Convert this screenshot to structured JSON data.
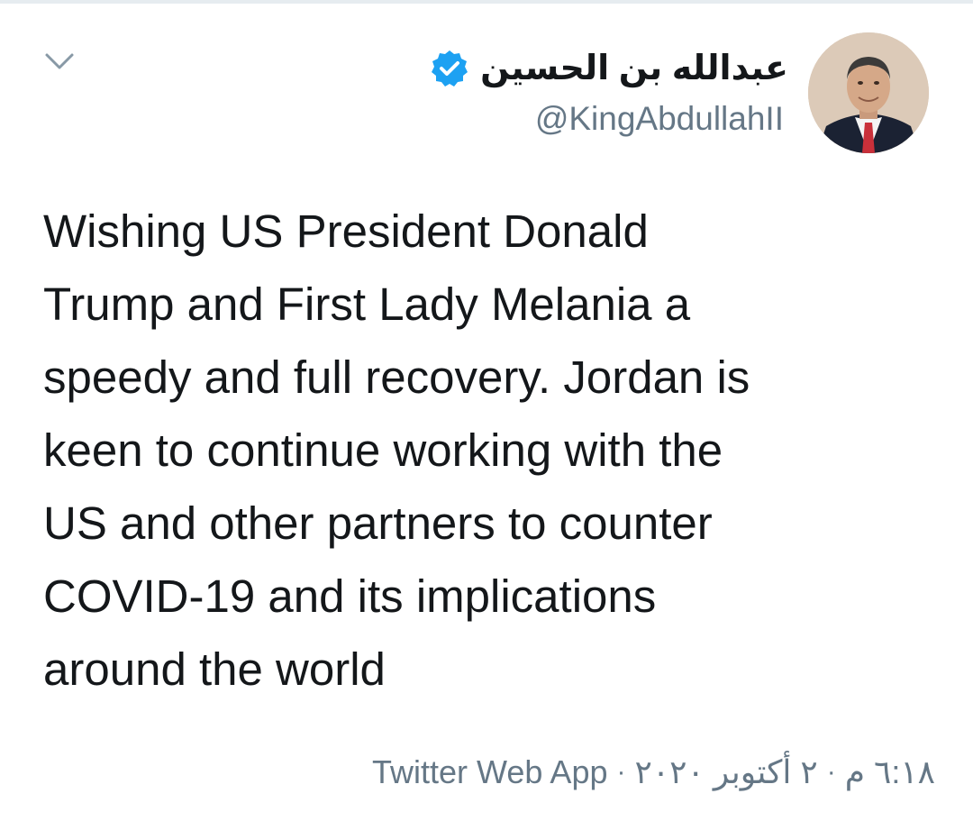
{
  "tweet": {
    "display_name": "عبدالله بن الحسين",
    "handle": "@KingAbdullahII",
    "text": "Wishing US President Donald\nTrump and First Lady Melania a\nspeedy and full recovery. Jordan is\nkeen to continue working with the\nUS and other partners to counter\nCOVID-19 and its implications\naround the world",
    "source": "Twitter Web App",
    "separator": "·",
    "date": "٢ أكتوبر ٢٠٢٠",
    "time": "٦:١٨ م"
  },
  "icons": {
    "menu": "chevron-down-icon",
    "verified": "verified-badge-icon",
    "avatar": "profile-photo"
  },
  "colors": {
    "text_primary": "#14171a",
    "text_secondary": "#657786",
    "verified_blue": "#1da1f2",
    "divider": "#e6ecf0"
  }
}
